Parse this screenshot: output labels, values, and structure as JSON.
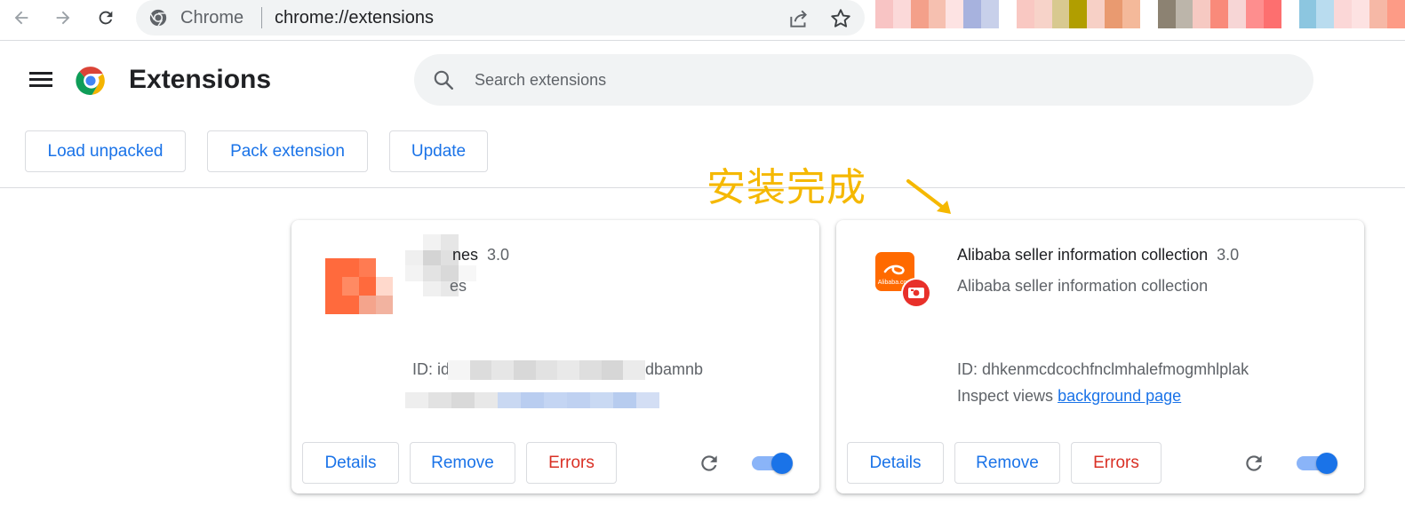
{
  "browser": {
    "site_label": "Chrome",
    "url": "chrome://extensions",
    "obscured_colors": [
      "#f8c4c4",
      "#fbd9d9",
      "#f4a08a",
      "#f6c0b0",
      "#fde3e3",
      "#a7b2de",
      "#c8d0ea",
      "#ffffff",
      "#f9c8c2",
      "#f7d3c9",
      "#d8c990",
      "#b19e00",
      "#f7d0c6",
      "#e99a70",
      "#f4b99a",
      "#ffffff",
      "#8c8272",
      "#bcb5aa",
      "#f6c9c2",
      "#f98a7a",
      "#f7d6d6",
      "#fe8e8e",
      "#fd6f6f",
      "#ffffff",
      "#8cc6e0",
      "#b9dcef",
      "#fbd7d7",
      "#fde2e2",
      "#f6b8a6",
      "#fd9b86"
    ]
  },
  "header": {
    "title": "Extensions",
    "search_placeholder": "Search extensions"
  },
  "toolbar": {
    "load_unpacked": "Load unpacked",
    "pack_extension": "Pack extension",
    "update": "Update"
  },
  "annotation": {
    "text": "安装完成"
  },
  "cards": [
    {
      "name": "nes",
      "version": "3.0",
      "description": "es",
      "id_label": "ID: idikr",
      "id_tail": "dbamnb",
      "buttons": {
        "details": "Details",
        "remove": "Remove",
        "errors": "Errors"
      },
      "enabled": true
    },
    {
      "name": "Alibaba seller information collection",
      "version": "3.0",
      "description": "Alibaba seller information collection",
      "id_label": "ID: dhkenmcdcochfnclmhalefmogmhlplak",
      "inspect_label": "Inspect views",
      "inspect_link": "background page",
      "icon_text": "Alibaba.com",
      "buttons": {
        "details": "Details",
        "remove": "Remove",
        "errors": "Errors"
      },
      "enabled": true
    }
  ],
  "colors": {
    "accent": "#1a73e8",
    "error": "#d93025",
    "annotation": "#f5b800",
    "alibaba_orange": "#ff6a00"
  }
}
